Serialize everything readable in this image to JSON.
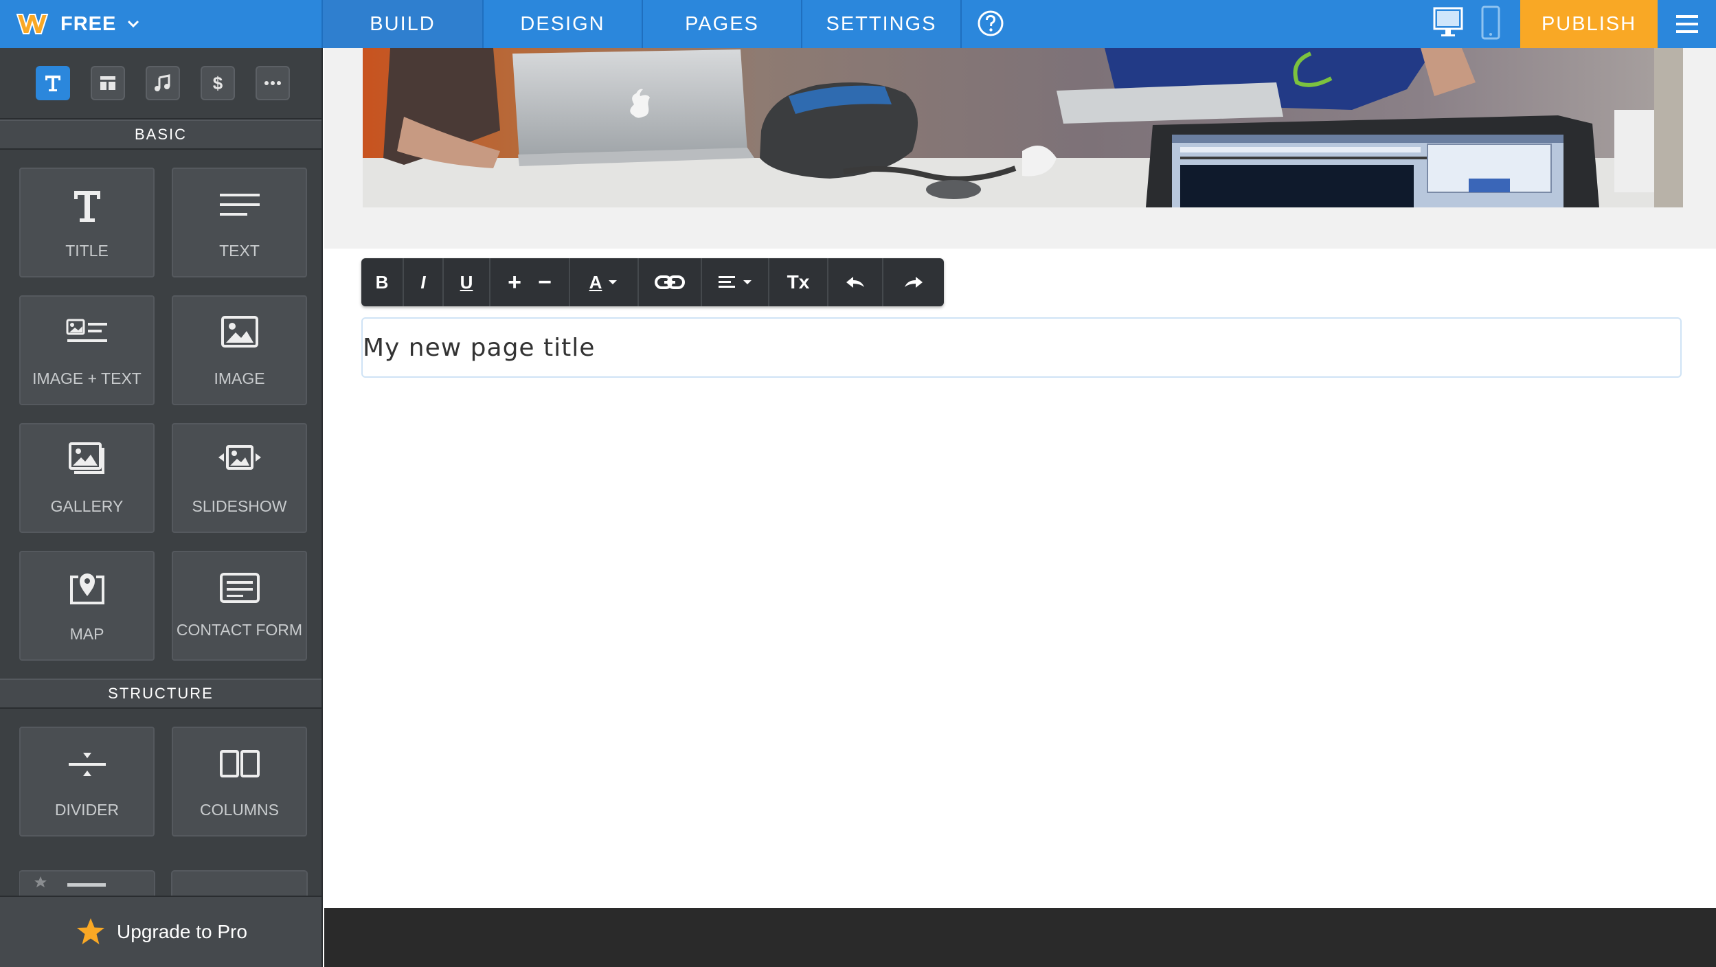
{
  "app": {
    "plan_label": "FREE",
    "accent_color": "#2b87dc",
    "publish_color": "#f9a825"
  },
  "nav": {
    "tabs": [
      "BUILD",
      "DESIGN",
      "PAGES",
      "SETTINGS"
    ],
    "active_tab": "BUILD",
    "publish_label": "PUBLISH",
    "icons": [
      "help-icon",
      "desktop-preview-icon",
      "mobile-preview-icon",
      "hamburger-menu-icon"
    ]
  },
  "sidebar": {
    "tool_tabs": [
      "text-tool-icon",
      "layout-tool-icon",
      "media-tool-icon",
      "commerce-tool-icon",
      "more-tool-icon"
    ],
    "basic_heading": "BASIC",
    "basic_items": [
      {
        "label": "TITLE",
        "icon": "title-icon"
      },
      {
        "label": "TEXT",
        "icon": "text-icon"
      },
      {
        "label": "IMAGE + TEXT",
        "icon": "image-text-icon"
      },
      {
        "label": "IMAGE",
        "icon": "image-icon"
      },
      {
        "label": "GALLERY",
        "icon": "gallery-icon"
      },
      {
        "label": "SLIDESHOW",
        "icon": "slideshow-icon"
      },
      {
        "label": "MAP",
        "icon": "map-icon"
      },
      {
        "label": "CONTACT FORM",
        "icon": "contact-form-icon"
      }
    ],
    "structure_heading": "STRUCTURE",
    "structure_items": [
      {
        "label": "DIVIDER",
        "icon": "divider-icon"
      },
      {
        "label": "COLUMNS",
        "icon": "columns-icon"
      }
    ],
    "upgrade_label": "Upgrade to Pro"
  },
  "editor": {
    "toolbar_buttons": [
      "B",
      "I",
      "U",
      "+",
      "−",
      "A",
      "link",
      "align",
      "Tx",
      "undo",
      "redo"
    ],
    "title_text": "My new page title"
  }
}
